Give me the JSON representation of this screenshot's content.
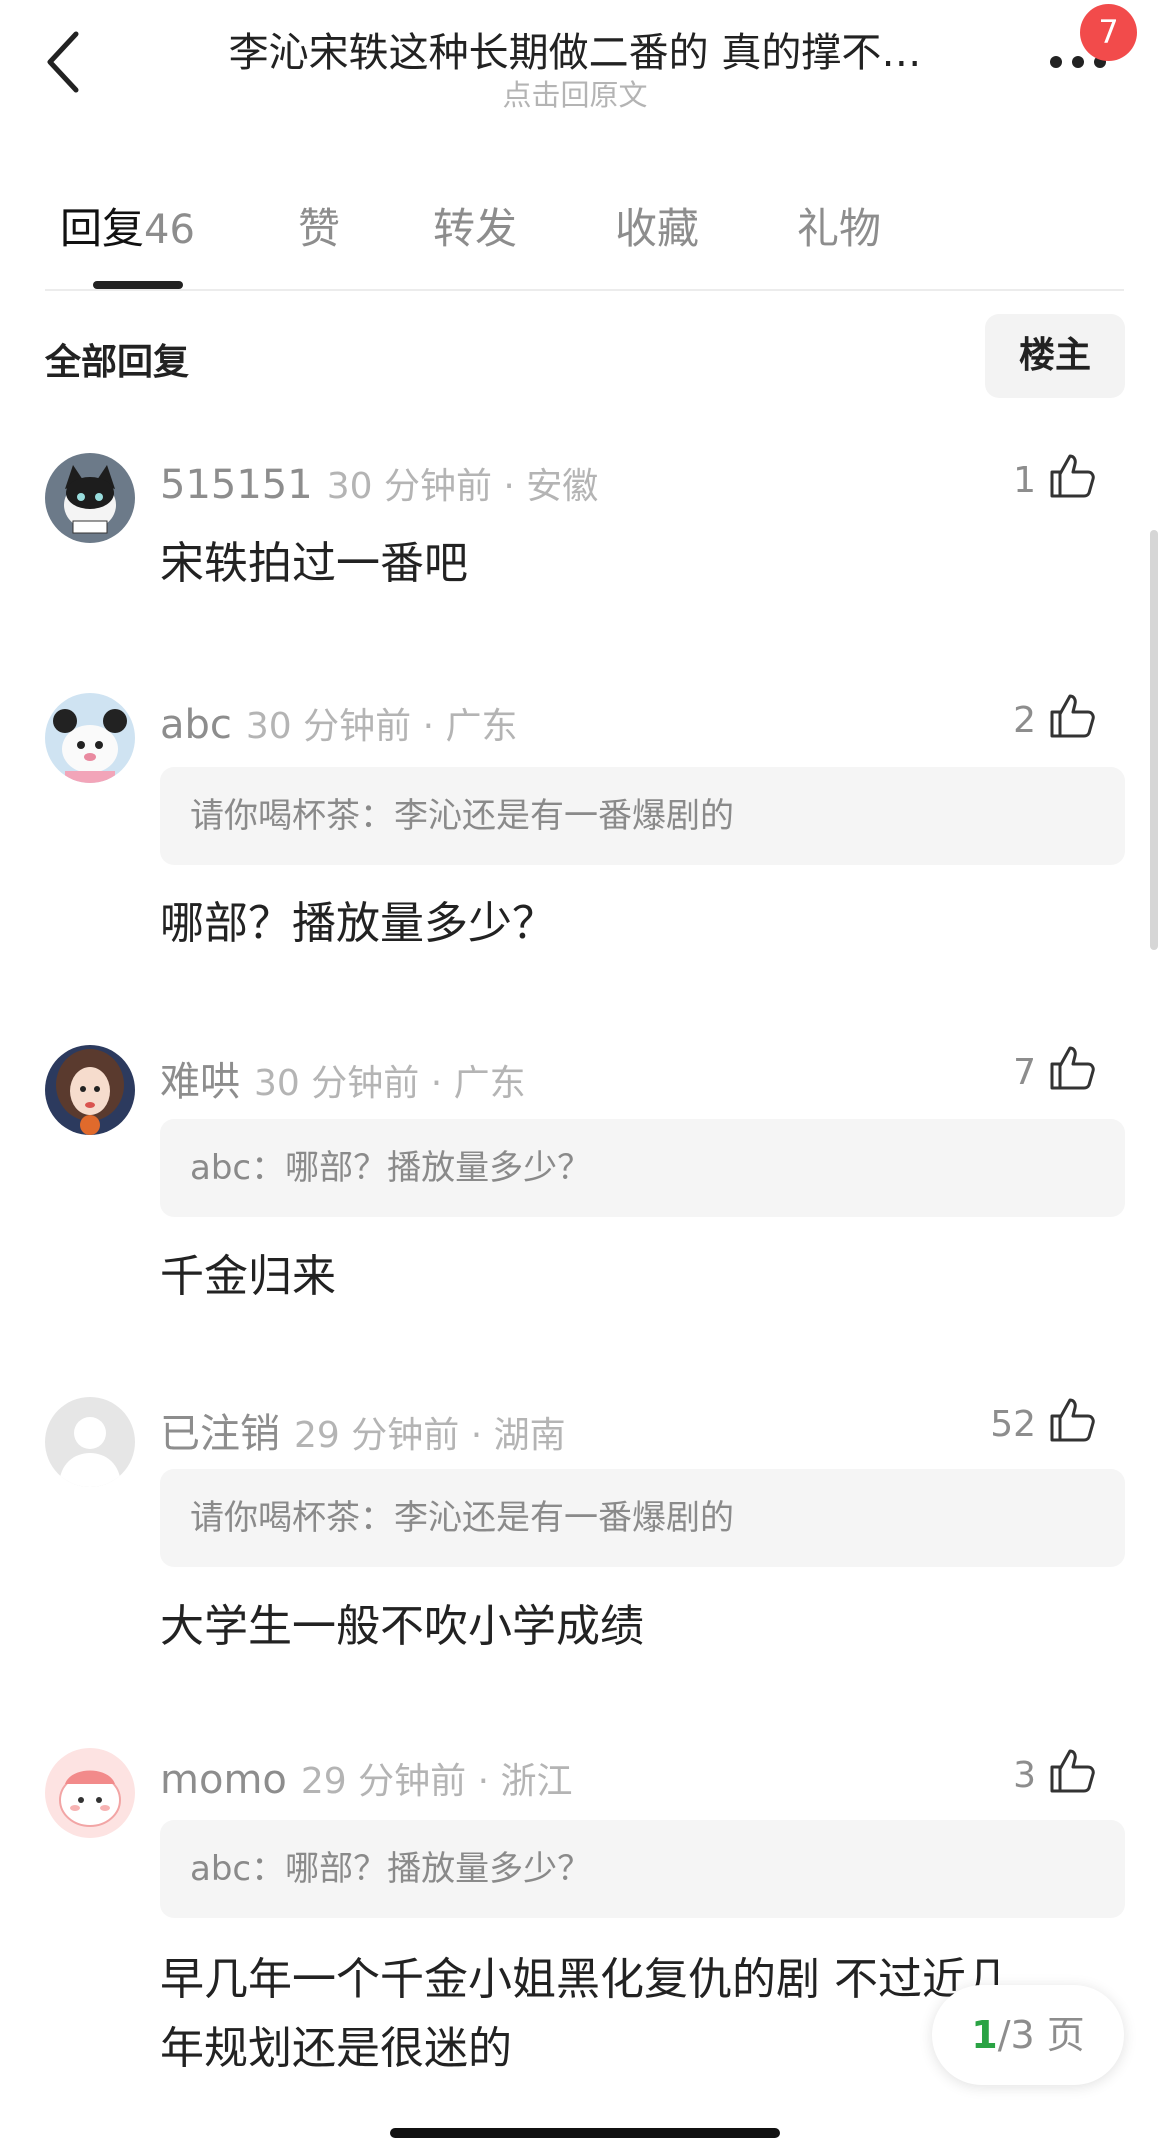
{
  "header": {
    "title": "李沁宋轶这种长期做二番的 真的撑不…",
    "subtitle": "点击回原文",
    "badge": "7"
  },
  "tabs": [
    {
      "label": "回复",
      "count": "46"
    },
    {
      "label": "赞"
    },
    {
      "label": "转发"
    },
    {
      "label": "收藏"
    },
    {
      "label": "礼物"
    }
  ],
  "section": {
    "title": "全部回复",
    "op_button": "楼主"
  },
  "comments": [
    {
      "username": "515151",
      "time": "30 分钟前 · 安徽",
      "likes": "1",
      "text": "宋轶拍过一番吧",
      "avatar": "cat-avatar"
    },
    {
      "username": "abc",
      "time": "30 分钟前 · 广东",
      "likes": "2",
      "quote": "请你喝杯茶：李沁还是有一番爆剧的",
      "text": "哪部？播放量多少？",
      "avatar": "plush-avatar"
    },
    {
      "username": "难哄",
      "time": "30 分钟前 · 广东",
      "likes": "7",
      "quote": "abc：哪部？播放量多少？",
      "text": "千金归来",
      "avatar": "girl-avatar"
    },
    {
      "username": "已注销",
      "time": "29 分钟前 · 湖南",
      "likes": "52",
      "quote": "请你喝杯茶：李沁还是有一番爆剧的",
      "text": "大学生一般不吹小学成绩",
      "avatar": "default-avatar"
    },
    {
      "username": "momo",
      "time": "29 分钟前 · 浙江",
      "likes": "3",
      "quote": "abc：哪部？播放量多少？",
      "text_line1": "早几年一个千金小姐黑化复仇的剧 不过近几",
      "text_line2": "年规划还是很迷的",
      "avatar": "pink-character-avatar"
    }
  ],
  "pager": {
    "current": "1",
    "total": "/3 页"
  },
  "colors": {
    "badge": "#f24b4b",
    "pager_current": "#2aa344",
    "muted_text": "#8d8d8d",
    "quote_bg": "#f5f5f5"
  }
}
